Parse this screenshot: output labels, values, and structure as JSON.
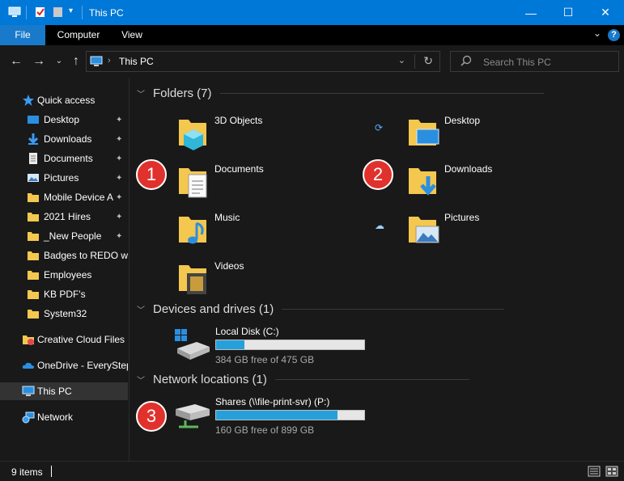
{
  "window": {
    "title": "This PC",
    "controls": {
      "minimize": "—",
      "maximize": "☐",
      "close": "✕"
    }
  },
  "ribbon": {
    "tabs": [
      "File",
      "Computer",
      "View"
    ],
    "expand": "⌄",
    "help": "?"
  },
  "address": {
    "path": "This PC",
    "separator": "›",
    "dropdown": "⌄",
    "refresh": "↻"
  },
  "search": {
    "placeholder": "Search This PC"
  },
  "nav": {
    "back": "←",
    "forward": "→",
    "recent": "⌄",
    "up": "↑",
    "quick_access": "Quick access",
    "items": [
      {
        "label": "Desktop",
        "pinned": true,
        "icon": "desktop-icon"
      },
      {
        "label": "Downloads",
        "pinned": true,
        "icon": "downloads-icon"
      },
      {
        "label": "Documents",
        "pinned": true,
        "icon": "documents-icon"
      },
      {
        "label": "Pictures",
        "pinned": true,
        "icon": "pictures-icon"
      },
      {
        "label": "Mobile Device A",
        "pinned": true,
        "icon": "folder-icon"
      },
      {
        "label": "2021 Hires",
        "pinned": true,
        "icon": "folder-icon"
      },
      {
        "label": "_New People",
        "pinned": true,
        "icon": "folder-icon"
      },
      {
        "label": "Badges to REDO wit",
        "pinned": false,
        "icon": "folder-icon"
      },
      {
        "label": "Employees",
        "pinned": false,
        "icon": "folder-icon"
      },
      {
        "label": "KB PDF's",
        "pinned": false,
        "icon": "folder-icon"
      },
      {
        "label": "System32",
        "pinned": false,
        "icon": "folder-icon"
      }
    ],
    "pin_glyph": "📌",
    "creative_cloud": "Creative Cloud Files",
    "onedrive": "OneDrive - EveryStep",
    "this_pc": "This PC",
    "network": "Network"
  },
  "main": {
    "folders_header": "Folders (7)",
    "folders": [
      {
        "name": "3D Objects",
        "icon": "3d-objects-icon"
      },
      {
        "name": "Desktop",
        "icon": "desktop-folder-icon"
      },
      {
        "name": "Documents",
        "icon": "documents-folder-icon"
      },
      {
        "name": "Downloads",
        "icon": "downloads-folder-icon"
      },
      {
        "name": "Music",
        "icon": "music-folder-icon"
      },
      {
        "name": "Pictures",
        "icon": "pictures-folder-icon"
      },
      {
        "name": "Videos",
        "icon": "videos-folder-icon"
      }
    ],
    "devices_header": "Devices and drives (1)",
    "local_disk": {
      "name": "Local Disk (C:)",
      "free_text": "384 GB free of 475 GB",
      "used_fraction": 0.19
    },
    "network_header": "Network locations (1)",
    "share": {
      "name": "Shares (\\\\file-print-svr) (P:)",
      "free_text": "160 GB free of 899 GB",
      "used_fraction": 0.82
    },
    "badges": [
      "1",
      "2",
      "3"
    ],
    "sync_glyph": "⟳",
    "cloud_glyph": "☁"
  },
  "status": {
    "count": "9 items"
  },
  "colors": {
    "accent": "#0078d7",
    "file_tab": "#1979ca",
    "badge": "#e1312c",
    "drive_fill": "#26a0da",
    "folder_yellow": "#f4c74f"
  }
}
